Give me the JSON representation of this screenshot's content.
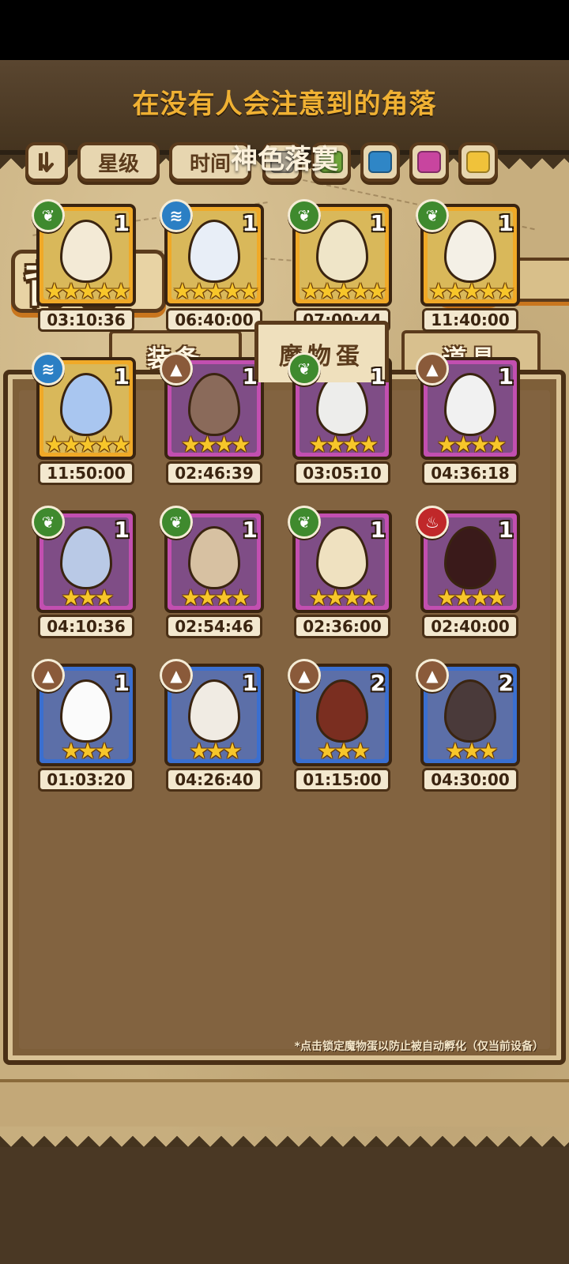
{
  "banner": {
    "title": "在没有人会注意到的角落",
    "subtitle": "神色落寞"
  },
  "header": {
    "title": "背包",
    "back_icon": "back-arrow-icon"
  },
  "tabs": [
    {
      "label": "装备",
      "active": false
    },
    {
      "label": "魔物蛋",
      "active": true
    },
    {
      "label": "道具",
      "active": false
    }
  ],
  "filters": {
    "sort_icon": "sort-toggle-icon",
    "star_label": "星级",
    "time_label": "时间",
    "rarity_colors": [
      "#a8a08f",
      "#6ea43a",
      "#2f86c6",
      "#c8459f",
      "#f0c23a"
    ]
  },
  "elements": {
    "leaf": {
      "icon": "leaf-element-icon",
      "color": "#3f8a2e"
    },
    "water": {
      "icon": "water-element-icon",
      "color": "#2b7fc4"
    },
    "earth": {
      "icon": "earth-element-icon",
      "color": "#8a5a3a"
    },
    "fire": {
      "icon": "fire-element-icon",
      "color": "#c0282a"
    }
  },
  "eggs": [
    {
      "element": "leaf",
      "count": "1",
      "stars": 5,
      "rarity": "gold",
      "timer": "03:10:36"
    },
    {
      "element": "water",
      "count": "1",
      "stars": 5,
      "rarity": "gold",
      "timer": "06:40:00"
    },
    {
      "element": "leaf",
      "count": "1",
      "stars": 5,
      "rarity": "gold",
      "timer": "07:00:44"
    },
    {
      "element": "leaf",
      "count": "1",
      "stars": 5,
      "rarity": "gold",
      "timer": "11:40:00"
    },
    {
      "element": "water",
      "count": "1",
      "stars": 5,
      "rarity": "gold",
      "timer": "11:50:00"
    },
    {
      "element": "earth",
      "count": "1",
      "stars": 4,
      "rarity": "purple",
      "timer": "02:46:39"
    },
    {
      "element": "leaf",
      "count": "1",
      "stars": 4,
      "rarity": "purple",
      "timer": "03:05:10"
    },
    {
      "element": "earth",
      "count": "1",
      "stars": 4,
      "rarity": "purple",
      "timer": "04:36:18"
    },
    {
      "element": "leaf",
      "count": "1",
      "stars": 3,
      "rarity": "purple",
      "timer": "04:10:36"
    },
    {
      "element": "leaf",
      "count": "1",
      "stars": 4,
      "rarity": "purple",
      "timer": "02:54:46"
    },
    {
      "element": "leaf",
      "count": "1",
      "stars": 4,
      "rarity": "purple",
      "timer": "02:36:00"
    },
    {
      "element": "fire",
      "count": "1",
      "stars": 4,
      "rarity": "purple",
      "timer": "02:40:00"
    },
    {
      "element": "earth",
      "count": "1",
      "stars": 3,
      "rarity": "blue",
      "timer": "01:03:20"
    },
    {
      "element": "earth",
      "count": "1",
      "stars": 3,
      "rarity": "blue",
      "timer": "04:26:40"
    },
    {
      "element": "earth",
      "count": "2",
      "stars": 3,
      "rarity": "blue",
      "timer": "01:15:00"
    },
    {
      "element": "earth",
      "count": "2",
      "stars": 3,
      "rarity": "blue",
      "timer": "04:30:00"
    }
  ],
  "rarity_styles": {
    "gold": {
      "frame": "#f0a927",
      "bg": "#d9b85a"
    },
    "purple": {
      "frame": "#c24fb0",
      "bg": "#7f4d86"
    },
    "blue": {
      "frame": "#3a6fd0",
      "bg": "#5c6fa8"
    }
  },
  "footnote": "*点击锁定魔物蛋以防止被自动孵化（仅当前设备）"
}
